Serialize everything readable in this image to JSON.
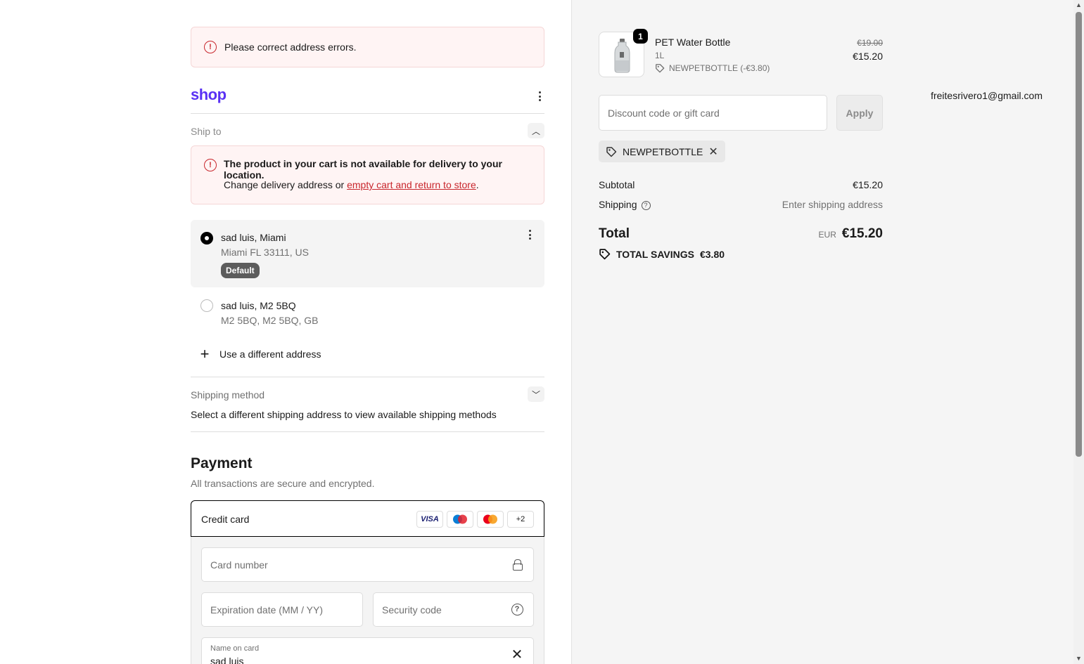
{
  "alerts": {
    "address_errors": "Please correct address errors."
  },
  "account": {
    "logo": "shop",
    "email": "freitesrivero1@gmail.com"
  },
  "ship_to": {
    "label": "Ship to",
    "warning_title": "The product in your cart is not available for delivery to your location.",
    "warning_prefix": "Change delivery address or ",
    "warning_link": "empty cart and return to store",
    "warning_suffix": ".",
    "addresses": [
      {
        "line1": "sad luis, Miami",
        "line2": "Miami FL 33111, US",
        "badge": "Default",
        "selected": true
      },
      {
        "line1": "sad luis, M2 5BQ",
        "line2": "M2 5BQ, M2 5BQ, GB",
        "selected": false
      }
    ],
    "use_different": "Use a different address"
  },
  "shipping_method": {
    "label": "Shipping method",
    "message": "Select a different shipping address to view available shipping methods"
  },
  "payment": {
    "title": "Payment",
    "subtitle": "All transactions are secure and encrypted.",
    "method_label": "Credit card",
    "card_brands": [
      "VISA",
      "Maestro",
      "Mastercard",
      "+2"
    ],
    "card_number_placeholder": "Card number",
    "expiration_placeholder": "Expiration date (MM / YY)",
    "security_placeholder": "Security code",
    "name_label": "Name on card",
    "name_value": "sad luis"
  },
  "summary": {
    "product": {
      "name": "PET Water Bottle",
      "variant": "1L",
      "discount": "NEWPETBOTTLE (-€3.80)",
      "old_price": "€19.00",
      "price": "€15.20",
      "quantity": "1"
    },
    "discount_placeholder": "Discount code or gift card",
    "apply_label": "Apply",
    "applied_code": "NEWPETBOTTLE",
    "subtotal_label": "Subtotal",
    "subtotal_value": "€15.20",
    "shipping_label": "Shipping",
    "shipping_value": "Enter shipping address",
    "total_label": "Total",
    "total_currency": "EUR",
    "total_value": "€15.20",
    "savings_label": "TOTAL SAVINGS",
    "savings_value": "€3.80"
  },
  "colors": {
    "brand": "#5a31f4",
    "error": "#c8262c",
    "error_bg": "#fff4f4"
  }
}
